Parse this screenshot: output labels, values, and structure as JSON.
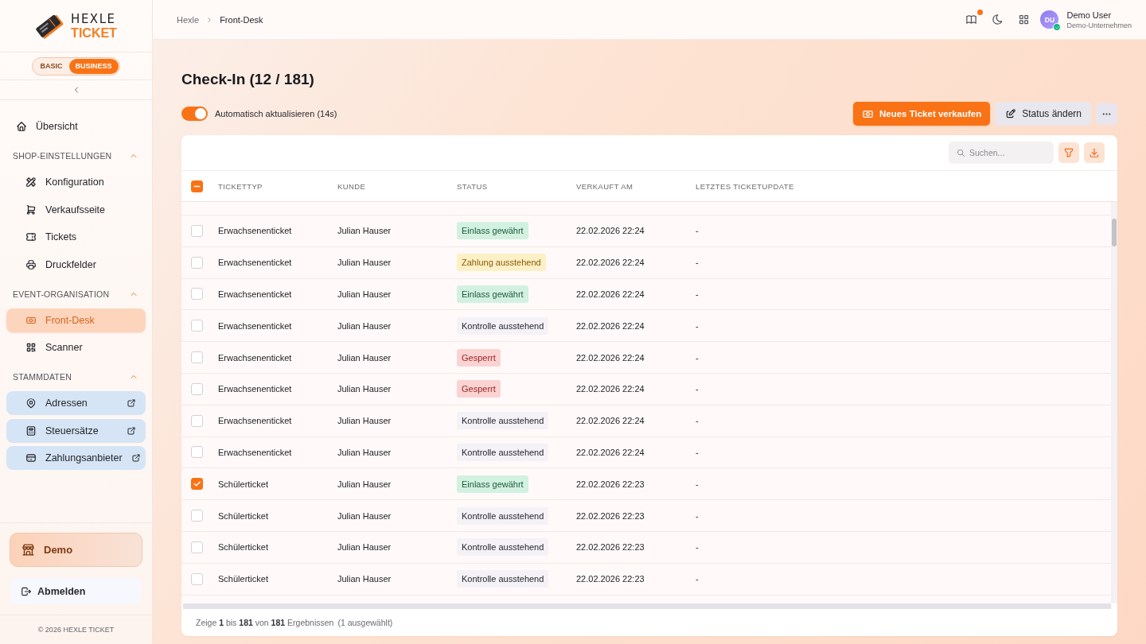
{
  "sidebar": {
    "logo": {
      "title": "HEXLE",
      "subtitle": "TICKET"
    },
    "plans": [
      {
        "label": "BASIC",
        "selected": false
      },
      {
        "label": "BUSINESS",
        "selected": true
      }
    ],
    "home": {
      "label": "Übersicht",
      "selected": false
    },
    "sections": [
      {
        "title": "SHOP-EINSTELLUNGEN",
        "expanded": true,
        "items": [
          {
            "label": "Konfiguration",
            "selected": false,
            "external": false
          },
          {
            "label": "Verkaufsseite",
            "selected": false,
            "external": false
          },
          {
            "label": "Tickets",
            "selected": false,
            "external": false
          },
          {
            "label": "Druckfelder",
            "selected": false,
            "external": false
          }
        ]
      },
      {
        "title": "EVENT-ORGANISATION",
        "expanded": true,
        "items": [
          {
            "label": "Front-Desk",
            "selected": true,
            "external": false
          },
          {
            "label": "Scanner",
            "selected": false,
            "external": false
          }
        ]
      },
      {
        "title": "STAMMDATEN",
        "expanded": true,
        "items": [
          {
            "label": "Adressen",
            "selected": false,
            "external": true
          },
          {
            "label": "Steuersätze",
            "selected": false,
            "external": true
          },
          {
            "label": "Zahlungsanbieter",
            "selected": false,
            "external": true
          }
        ]
      }
    ],
    "store": {
      "label": "Demo"
    },
    "logout": {
      "label": "Abmelden"
    },
    "copyright": "© 2026 HEXLE TICKET"
  },
  "topbar": {
    "breadcrumb": [
      {
        "label": "Hexle"
      },
      {
        "label": "Front-Desk"
      }
    ],
    "notifications": {
      "unread": true
    },
    "user": {
      "initials": "DU",
      "name": "Demo User",
      "company": "Demo-Unternehmen",
      "verified": true
    }
  },
  "page": {
    "title": "Check-In (12 / 181)",
    "auto_refresh": {
      "label": "Automatisch aktualisieren (14s)",
      "on": true
    },
    "actions": [
      {
        "kind": "primary",
        "label": "Neues Ticket verkaufen"
      },
      {
        "kind": "secondary",
        "label": "Status ändern"
      },
      {
        "kind": "more"
      }
    ]
  },
  "table": {
    "search": {
      "placeholder": "Suchen..."
    },
    "select_all": {
      "indeterminate": true
    },
    "columns": [
      "TICKETTYP",
      "KUNDE",
      "STATUS",
      "VERKAUFT AM",
      "LETZTES TICKETUPDATE"
    ],
    "rows": [
      {
        "selected": false,
        "ticket_type": "Erwachsenenticket",
        "customer": "Julian Hauser",
        "status": {
          "label": "Einlass gewährt",
          "kind": "granted"
        },
        "sold_at": "22.02.2026 22:24",
        "last_update": "-"
      },
      {
        "selected": false,
        "ticket_type": "Erwachsenenticket",
        "customer": "Julian Hauser",
        "status": {
          "label": "Zahlung ausstehend",
          "kind": "payment"
        },
        "sold_at": "22.02.2026 22:24",
        "last_update": "-"
      },
      {
        "selected": false,
        "ticket_type": "Erwachsenenticket",
        "customer": "Julian Hauser",
        "status": {
          "label": "Einlass gewährt",
          "kind": "granted"
        },
        "sold_at": "22.02.2026 22:24",
        "last_update": "-"
      },
      {
        "selected": false,
        "ticket_type": "Erwachsenenticket",
        "customer": "Julian Hauser",
        "status": {
          "label": "Kontrolle ausstehend",
          "kind": "pending"
        },
        "sold_at": "22.02.2026 22:24",
        "last_update": "-"
      },
      {
        "selected": false,
        "ticket_type": "Erwachsenenticket",
        "customer": "Julian Hauser",
        "status": {
          "label": "Gesperrt",
          "kind": "blocked"
        },
        "sold_at": "22.02.2026 22:24",
        "last_update": "-"
      },
      {
        "selected": false,
        "ticket_type": "Erwachsenenticket",
        "customer": "Julian Hauser",
        "status": {
          "label": "Gesperrt",
          "kind": "blocked"
        },
        "sold_at": "22.02.2026 22:24",
        "last_update": "-"
      },
      {
        "selected": false,
        "ticket_type": "Erwachsenenticket",
        "customer": "Julian Hauser",
        "status": {
          "label": "Kontrolle ausstehend",
          "kind": "pending"
        },
        "sold_at": "22.02.2026 22:24",
        "last_update": "-"
      },
      {
        "selected": false,
        "ticket_type": "Erwachsenenticket",
        "customer": "Julian Hauser",
        "status": {
          "label": "Kontrolle ausstehend",
          "kind": "pending"
        },
        "sold_at": "22.02.2026 22:24",
        "last_update": "-"
      },
      {
        "selected": true,
        "ticket_type": "Schülerticket",
        "customer": "Julian Hauser",
        "status": {
          "label": "Einlass gewährt",
          "kind": "granted"
        },
        "sold_at": "22.02.2026 22:23",
        "last_update": "-"
      },
      {
        "selected": false,
        "ticket_type": "Schülerticket",
        "customer": "Julian Hauser",
        "status": {
          "label": "Kontrolle ausstehend",
          "kind": "pending"
        },
        "sold_at": "22.02.2026 22:23",
        "last_update": "-"
      },
      {
        "selected": false,
        "ticket_type": "Schülerticket",
        "customer": "Julian Hauser",
        "status": {
          "label": "Kontrolle ausstehend",
          "kind": "pending"
        },
        "sold_at": "22.02.2026 22:23",
        "last_update": "-"
      },
      {
        "selected": false,
        "ticket_type": "Schülerticket",
        "customer": "Julian Hauser",
        "status": {
          "label": "Kontrolle ausstehend",
          "kind": "pending"
        },
        "sold_at": "22.02.2026 22:23",
        "last_update": "-"
      }
    ],
    "footer": {
      "summary": "Zeige **1** bis **181** von **181** Ergebnissen",
      "selection": "(1 ausgewählt)"
    }
  }
}
